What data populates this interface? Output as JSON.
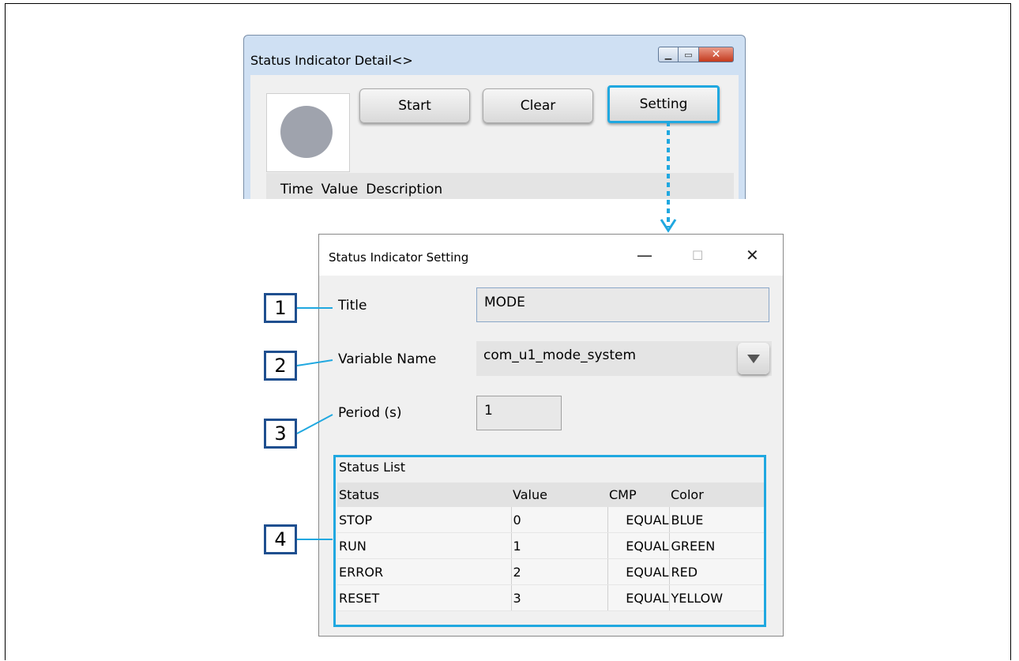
{
  "detail_window": {
    "title": "Status Indicator Detail<>",
    "buttons": {
      "start": "Start",
      "clear": "Clear",
      "setting": "Setting"
    },
    "columns": [
      "Time",
      "Value",
      "Description"
    ]
  },
  "setting_window": {
    "title": "Status Indicator Setting",
    "controls": {
      "minimize": "—",
      "maximize": "☐",
      "close": "✕"
    },
    "fields": {
      "title_label": "Title",
      "title_value": "MODE",
      "variable_label": "Variable Name",
      "variable_value": "com_u1_mode_system",
      "period_label": "Period (s)",
      "period_value": "1"
    },
    "status_list": {
      "title": "Status List",
      "columns": [
        "Status",
        "Value",
        "CMP",
        "Color"
      ],
      "rows": [
        [
          "STOP",
          "0",
          "EQUAL",
          "BLUE"
        ],
        [
          "RUN",
          "1",
          "EQUAL",
          "GREEN"
        ],
        [
          "ERROR",
          "2",
          "EQUAL",
          "RED"
        ],
        [
          "RESET",
          "3",
          "EQUAL",
          "YELLOW"
        ]
      ]
    }
  },
  "callouts": [
    "1",
    "2",
    "3",
    "4"
  ],
  "colors": {
    "highlight": "#20a8e0",
    "callout_border": "#1f4f8f",
    "indicator": "#9fa3ad"
  }
}
